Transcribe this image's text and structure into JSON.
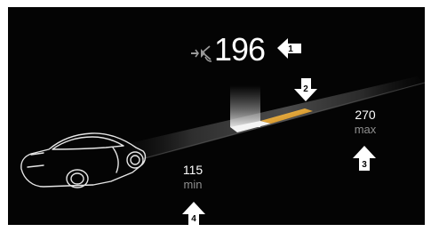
{
  "range_display": {
    "current_range": "196",
    "max_value": "270",
    "max_label": "max",
    "min_value": "115",
    "min_label": "min",
    "icon": "plug-charging-icon"
  },
  "callouts": {
    "c1": "1",
    "c2": "2",
    "c3": "3",
    "c4": "4"
  },
  "colors": {
    "background": "#040404",
    "bar_highlight": "#e2a22c",
    "text_secondary": "#8e8e8e"
  }
}
